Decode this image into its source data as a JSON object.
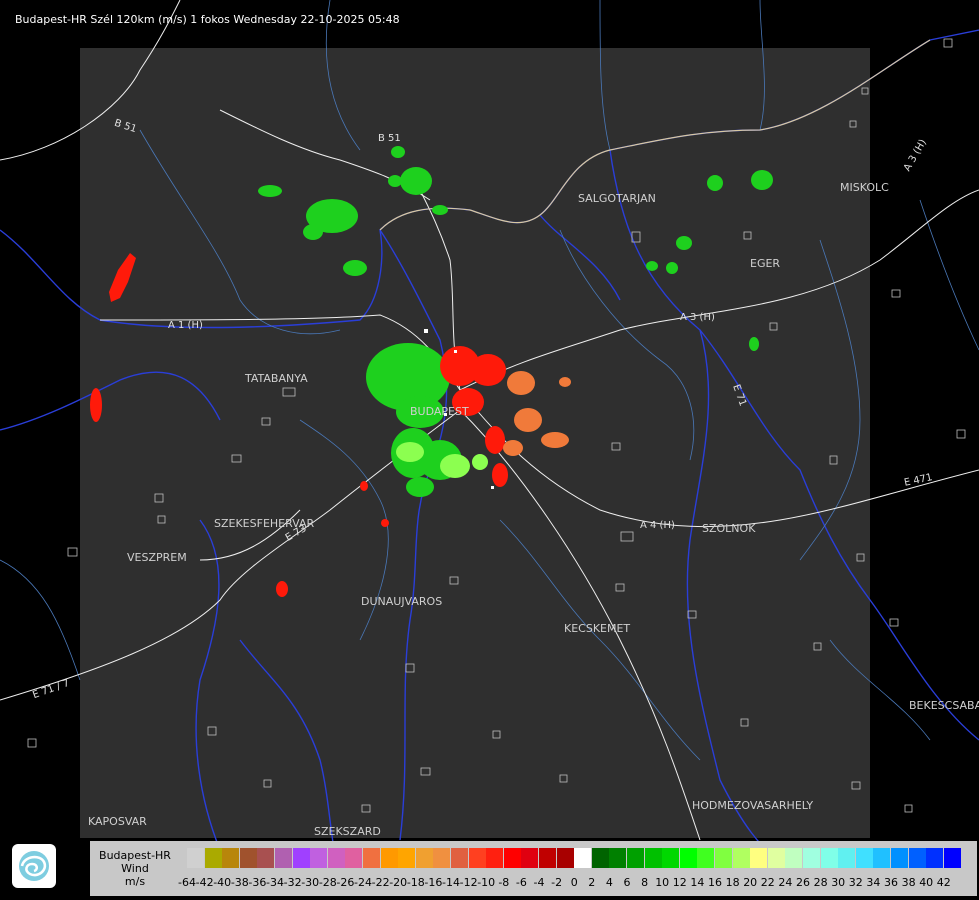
{
  "title": "Budapest-HR Szél 120km (m/s) 1 fokos Wednesday 22-10-2025 05:48",
  "cities": [
    "SALGOTARJAN",
    "MISKOLC",
    "EGER",
    "TATABANYA",
    "BUDAPEST",
    "SZEKESFEHERVAR",
    "VESZPREM",
    "DUNAUJVAROS",
    "KECSKEMET",
    "SZOLNOK",
    "BEKESCSABA",
    "HODMEZOVASARHELY",
    "KAPOSVAR",
    "SZEKSZARD"
  ],
  "roads": [
    "B 51",
    "B 51",
    "A 1 (H)",
    "A 3 (H)",
    "A 3 (H)",
    "A 4 (H)",
    "E 71",
    "E 71 / 7",
    "E 73",
    "E 471"
  ],
  "legend": {
    "title_line1": "Budapest-HR",
    "title_line2": "Wind",
    "unit": "m/s",
    "ticks": [
      "-64",
      "-42",
      "-40",
      "-38",
      "-36",
      "-34",
      "-32",
      "-30",
      "-28",
      "-26",
      "-24",
      "-22",
      "-20",
      "-18",
      "-16",
      "-14",
      "-12",
      "-10",
      "-8",
      "-6",
      "-4",
      "-2",
      "0",
      "2",
      "4",
      "6",
      "8",
      "10",
      "12",
      "14",
      "16",
      "18",
      "20",
      "22",
      "24",
      "26",
      "28",
      "30",
      "32",
      "34",
      "36",
      "38",
      "40",
      "42"
    ],
    "colors": [
      "#d0d0d0",
      "#aaaa00",
      "#b8860b",
      "#a0522d",
      "#a85050",
      "#b060b0",
      "#a040ff",
      "#c060e0",
      "#d060c0",
      "#e060a0",
      "#f07040",
      "#ff9900",
      "#ffa500",
      "#f0a030",
      "#f09040",
      "#e06040",
      "#ff4020",
      "#ff2010",
      "#ff0000",
      "#e00010",
      "#c00000",
      "#a80000",
      "#ffffff",
      "#006400",
      "#008000",
      "#00a000",
      "#00c000",
      "#00d800",
      "#00ff00",
      "#40ff20",
      "#80ff40",
      "#b0ff60",
      "#ffff80",
      "#e0ffa0",
      "#c0ffc0",
      "#a0ffe0",
      "#80ffe8",
      "#60f0f0",
      "#40e0ff",
      "#20c0ff",
      "#0090ff",
      "#0060ff",
      "#0030ff",
      "#0000ff"
    ]
  },
  "icons": {
    "logo": "omsz-logo-icon"
  }
}
